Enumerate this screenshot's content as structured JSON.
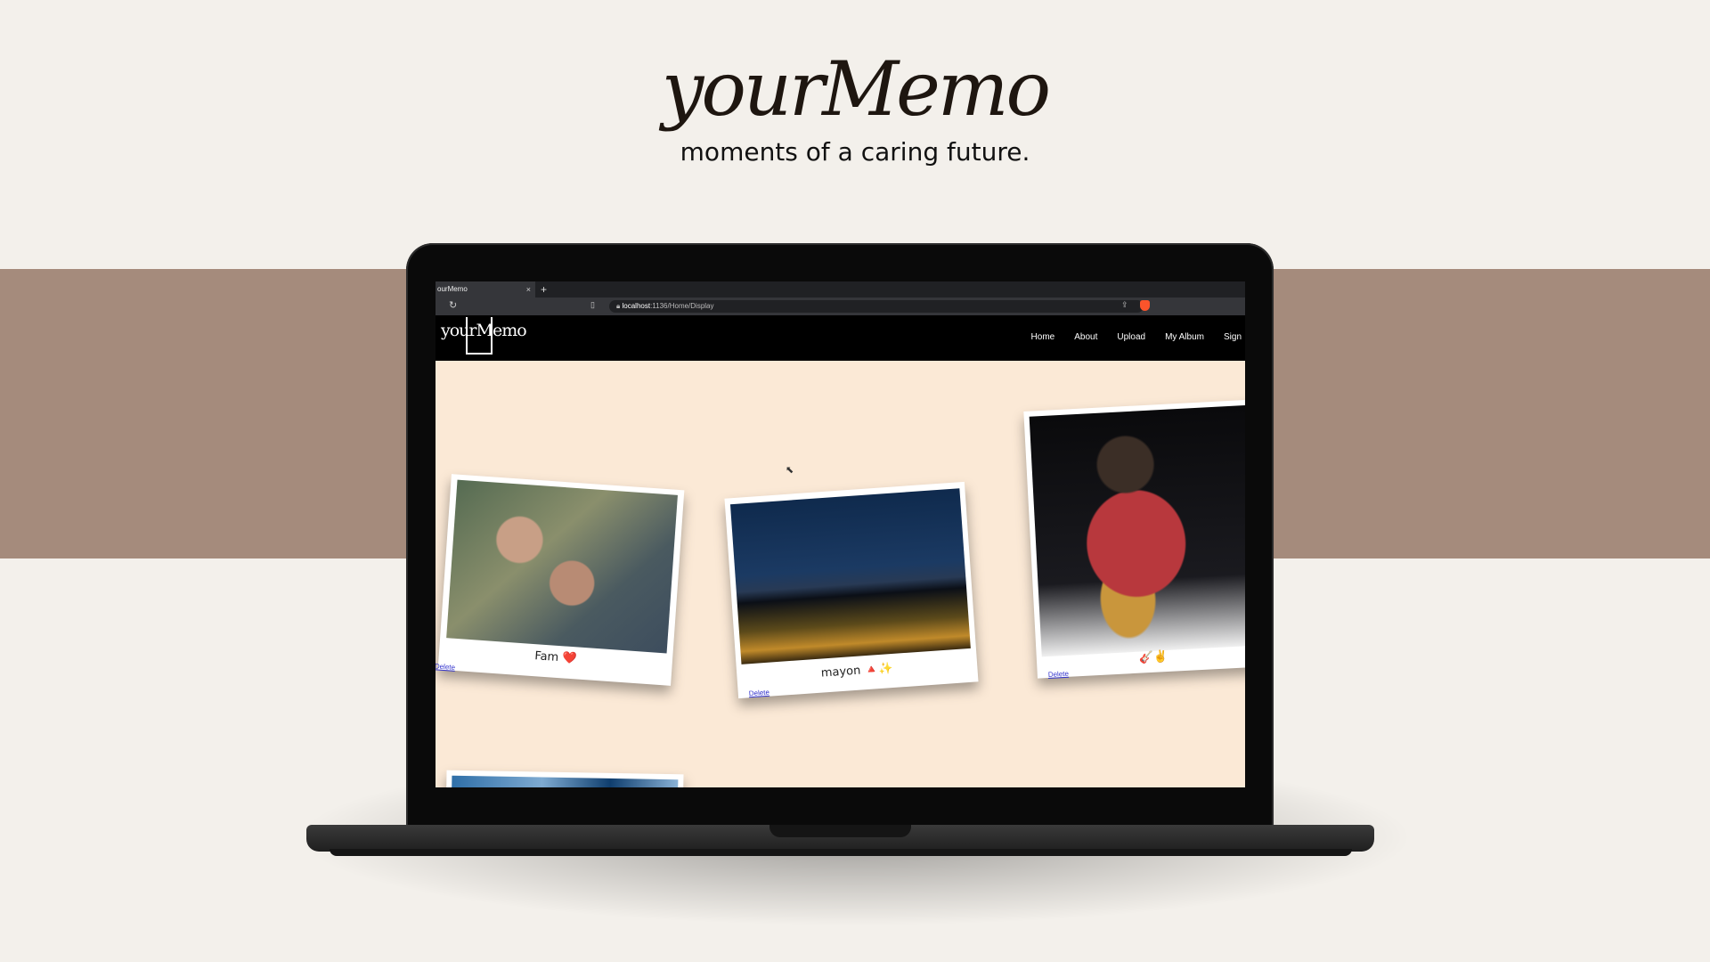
{
  "hero": {
    "title": "yourMemo",
    "subtitle": "moments of a caring future."
  },
  "browser": {
    "tab_title": "ourMemo",
    "tab_close": "×",
    "new_tab": "+",
    "url_host": "localhost",
    "url_path": ":1136/Home/Display"
  },
  "site": {
    "logo": "yourMemo",
    "nav": [
      "Home",
      "About",
      "Upload",
      "My Album",
      "Sign"
    ]
  },
  "album": {
    "cards": [
      {
        "caption": "Fam",
        "emoji": "❤️",
        "delete_label": "Delete"
      },
      {
        "caption": "mayon",
        "emoji": "🔺✨",
        "delete_label": "Delete"
      },
      {
        "caption": "",
        "emoji": "🎸✌️",
        "delete_label": "Delete"
      }
    ]
  },
  "colors": {
    "background": "#f3f0eb",
    "band": "#a58b7c",
    "page_bg": "#fbe9d6"
  }
}
